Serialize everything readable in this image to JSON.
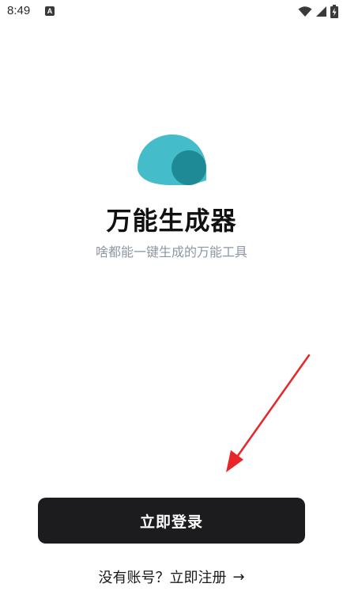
{
  "status_bar": {
    "time": "8:49",
    "notification_icon": "A",
    "icons": [
      "wifi-icon",
      "signal-icon",
      "battery-charging-icon"
    ]
  },
  "app": {
    "title": "万能生成器",
    "subtitle": "啥都能一键生成的万能工具",
    "logo_colors": {
      "light": "#44bcc9",
      "dark": "#1e8a95"
    }
  },
  "actions": {
    "login_label": "立即登录",
    "register_prompt": "没有账号？立即注册",
    "register_arrow": "→"
  },
  "annotation": {
    "arrow_color": "#e8262a"
  }
}
